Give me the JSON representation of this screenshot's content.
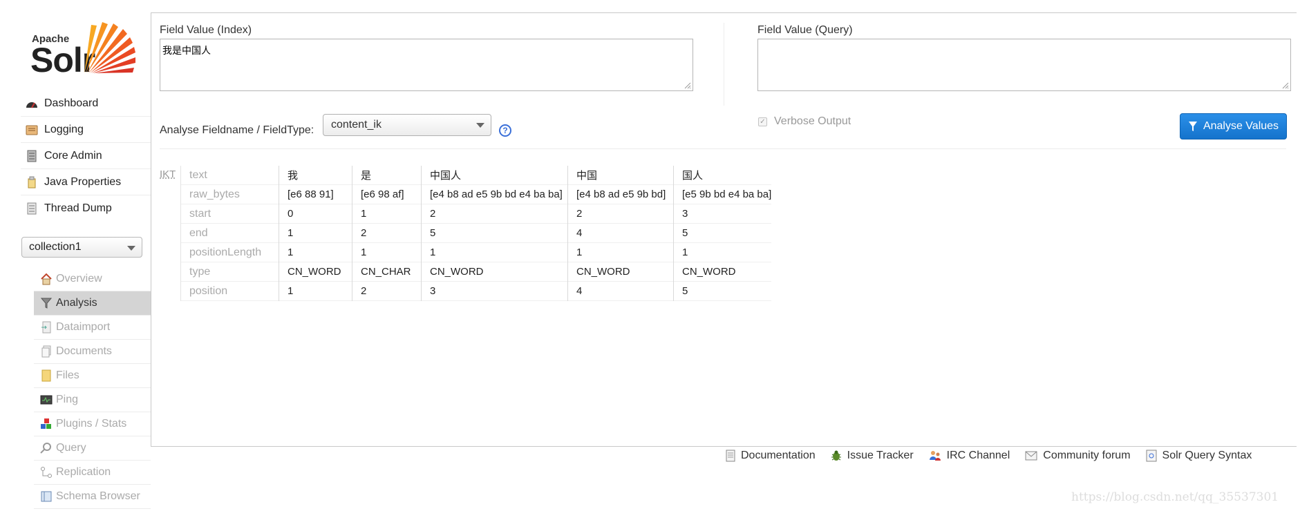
{
  "logo": {
    "apache": "Apache",
    "solr": "Solr"
  },
  "sidebar": {
    "main_nav": [
      {
        "label": "Dashboard",
        "icon": "dashboard-icon"
      },
      {
        "label": "Logging",
        "icon": "logging-icon"
      },
      {
        "label": "Core Admin",
        "icon": "core-admin-icon"
      },
      {
        "label": "Java Properties",
        "icon": "java-properties-icon"
      },
      {
        "label": "Thread Dump",
        "icon": "thread-dump-icon"
      }
    ],
    "core_selector": "collection1",
    "core_nav": [
      {
        "label": "Overview",
        "icon": "home-icon"
      },
      {
        "label": "Analysis",
        "icon": "funnel-icon",
        "active": true
      },
      {
        "label": "Dataimport",
        "icon": "dataimport-icon"
      },
      {
        "label": "Documents",
        "icon": "documents-icon"
      },
      {
        "label": "Files",
        "icon": "files-icon"
      },
      {
        "label": "Ping",
        "icon": "ping-icon"
      },
      {
        "label": "Plugins / Stats",
        "icon": "plugins-icon"
      },
      {
        "label": "Query",
        "icon": "query-icon"
      },
      {
        "label": "Replication",
        "icon": "replication-icon"
      },
      {
        "label": "Schema Browser",
        "icon": "schema-browser-icon"
      }
    ]
  },
  "analysis": {
    "index_label": "Field Value (Index)",
    "index_value": "我是中国人",
    "query_label": "Field Value (Query)",
    "query_value": "",
    "fieldtype_label": "Analyse Fieldname / FieldType:",
    "fieldtype_value": "content_ik",
    "verbose_label": "Verbose Output",
    "verbose_checked": true,
    "analyse_button": "Analyse Values"
  },
  "results": {
    "stage": "IKT",
    "attributes": [
      "text",
      "raw_bytes",
      "start",
      "end",
      "positionLength",
      "type",
      "position"
    ],
    "tokens": [
      [
        "我",
        "[e6 88 91]",
        "0",
        "1",
        "1",
        "CN_WORD",
        "1"
      ],
      [
        "是",
        "[e6 98 af]",
        "1",
        "2",
        "1",
        "CN_CHAR",
        "2"
      ],
      [
        "中国人",
        "[e4 b8 ad e5 9b bd e4 ba ba]",
        "2",
        "5",
        "1",
        "CN_WORD",
        "3"
      ],
      [
        "中国",
        "[e4 b8 ad e5 9b bd]",
        "2",
        "4",
        "1",
        "CN_WORD",
        "4"
      ],
      [
        "国人",
        "[e5 9b bd e4 ba ba]",
        "3",
        "5",
        "1",
        "CN_WORD",
        "5"
      ]
    ]
  },
  "footer": [
    {
      "label": "Documentation",
      "icon": "documentation-icon"
    },
    {
      "label": "Issue Tracker",
      "icon": "bug-icon"
    },
    {
      "label": "IRC Channel",
      "icon": "irc-icon"
    },
    {
      "label": "Community forum",
      "icon": "mail-icon"
    },
    {
      "label": "Solr Query Syntax",
      "icon": "query-syntax-icon"
    }
  ],
  "watermark": "https://blog.csdn.net/qq_35537301",
  "colors": {
    "accent": "#1a7fd9",
    "active_bg": "#d4d4d4",
    "logo_orange": "#f26a21"
  }
}
